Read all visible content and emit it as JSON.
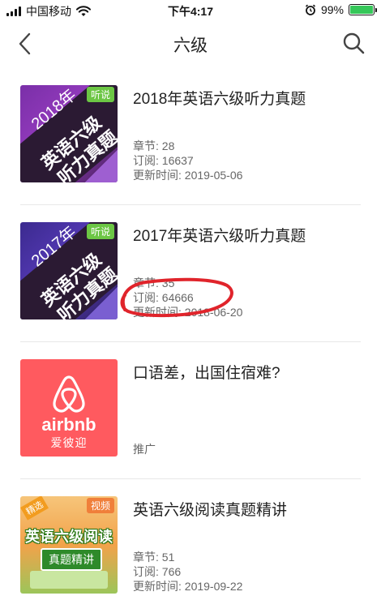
{
  "status_bar": {
    "carrier": "中国移动",
    "time": "下午4:17",
    "battery_percent": "99%",
    "battery_level": 0.99
  },
  "nav": {
    "title": "六级",
    "back_icon": "chevron-left-icon",
    "search_icon": "search-icon"
  },
  "items": [
    {
      "title": "2018年英语六级听力真题",
      "cover": {
        "year": "2018年",
        "line1": "英语六级",
        "line2": "听力真题",
        "tag": "听说"
      },
      "meta": [
        "章节: 28",
        "订阅: 16637",
        "更新时间: 2019-05-06"
      ]
    },
    {
      "title": "2017年英语六级听力真题",
      "cover": {
        "year": "2017年",
        "line1": "英语六级",
        "line2": "听力真题",
        "tag": "听说"
      },
      "meta": [
        "章节: 35",
        "订阅: 64666",
        "更新时间: 2018-06-20"
      ]
    },
    {
      "title": "口语差，出国住宿难?",
      "cover": {
        "brand": "airbnb",
        "brand_cn": "爱彼迎"
      },
      "meta": [
        "推广"
      ]
    },
    {
      "title": "英语六级阅读真题精讲",
      "cover": {
        "tag_left": "精选",
        "tag_right": "视频",
        "line1": "英语六级阅读",
        "line2": "真题精讲"
      },
      "meta": [
        "章节: 51",
        "订阅: 766",
        "更新时间: 2019-09-22"
      ]
    }
  ],
  "colors": {
    "accent_green": "#35c759",
    "airbnb_red": "#ff5a5f",
    "annotation_red": "#e0242b"
  }
}
